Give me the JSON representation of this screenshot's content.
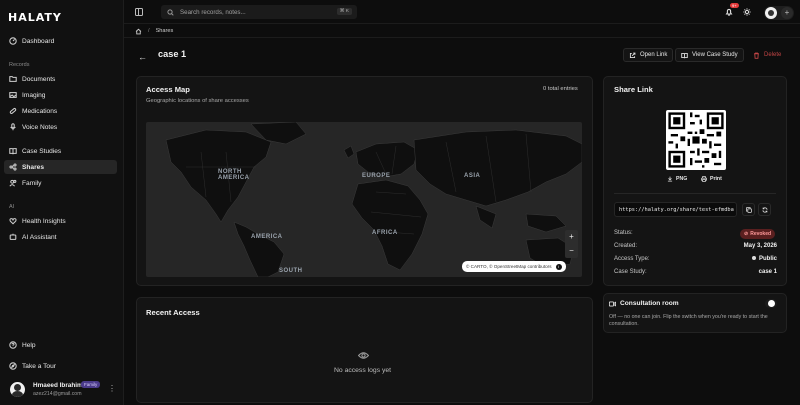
{
  "app": {
    "logo": "HALATY"
  },
  "sidebar": {
    "top": [
      {
        "label": "Dashboard",
        "icon": "dashboard-icon"
      }
    ],
    "records_label": "Records",
    "records": [
      {
        "label": "Documents",
        "icon": "folder-icon"
      },
      {
        "label": "Imaging",
        "icon": "image-icon"
      },
      {
        "label": "Medications",
        "icon": "pill-icon"
      },
      {
        "label": "Voice Notes",
        "icon": "mic-icon"
      }
    ],
    "other": [
      {
        "label": "Case Studies",
        "icon": "book-icon"
      },
      {
        "label": "Shares",
        "icon": "share-icon",
        "active": true
      },
      {
        "label": "Family",
        "icon": "users-icon"
      }
    ],
    "ai_label": "AI",
    "ai": [
      {
        "label": "Health Insights",
        "icon": "heart-icon"
      },
      {
        "label": "AI Assistant",
        "icon": "sparkle-icon"
      }
    ],
    "bottom": [
      {
        "label": "Help",
        "icon": "help-icon"
      },
      {
        "label": "Take a Tour",
        "icon": "compass-icon"
      }
    ],
    "user": {
      "name": "Hmaeed Ibrahim",
      "badge": "Family",
      "email": "azez214@gmail.com"
    }
  },
  "topbar": {
    "search_placeholder": "Search records, notes...",
    "shortcut": "⌘ K",
    "notification_count": "9+"
  },
  "breadcrumb": {
    "current": "Shares"
  },
  "header": {
    "title": "case 1",
    "open_link": "Open Link",
    "view_case_study": "View Case Study",
    "delete": "Delete"
  },
  "access_map": {
    "title": "Access Map",
    "subtitle": "Geographic locations of share accesses",
    "total": "0 total entries",
    "labels": [
      "NORTH\nAMERICA",
      "EUROPE",
      "ASIA",
      "AFRICA",
      "AMERICA",
      "SOUTH"
    ],
    "zoom_in": "+",
    "zoom_out": "−",
    "attribution": "© CARTO, © OpenStreetMap contributors"
  },
  "recent_access": {
    "title": "Recent Access",
    "empty": "No access logs yet"
  },
  "share": {
    "title": "Share Link",
    "png": "PNG",
    "print": "Print",
    "url": "https://halaty.org/share/test-efmdba",
    "status_label": "Status:",
    "status_value": "Revoked",
    "created_label": "Created:",
    "created_value": "May 3, 2026",
    "access_label": "Access Type:",
    "access_value": "Public",
    "case_label": "Case Study:",
    "case_value": "case 1"
  },
  "consultation": {
    "title": "Consultation room",
    "description": "Off — no one can join. Flip the switch when you're ready to start the consultation."
  }
}
